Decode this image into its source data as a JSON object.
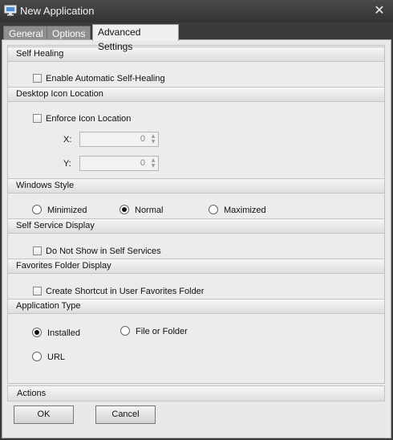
{
  "window": {
    "title": "New Application",
    "icon": "monitor-icon",
    "close_glyph": "✕"
  },
  "tabs": [
    {
      "label": "General",
      "active": false
    },
    {
      "label": "Options",
      "active": false
    },
    {
      "label": "Advanced Settings",
      "active": true
    }
  ],
  "sections": {
    "self_healing": {
      "title": "Self Healing",
      "checkbox": {
        "label": "Enable Automatic Self-Healing",
        "checked": false
      }
    },
    "desktop_icon": {
      "title": "Desktop Icon Location",
      "checkbox": {
        "label": "Enforce Icon Location",
        "checked": false
      },
      "x_label": "X:",
      "x_value": "0",
      "y_label": "Y:",
      "y_value": "0"
    },
    "windows_style": {
      "title": "Windows Style",
      "options": [
        {
          "label": "Minimized",
          "selected": false
        },
        {
          "label": "Normal",
          "selected": true
        },
        {
          "label": "Maximized",
          "selected": false
        }
      ]
    },
    "self_service": {
      "title": "Self Service Display",
      "checkbox": {
        "label": "Do Not Show in Self Services",
        "checked": false
      }
    },
    "favorites": {
      "title": "Favorites Folder Display",
      "checkbox": {
        "label": "Create Shortcut in User Favorites Folder",
        "checked": false
      }
    },
    "app_type": {
      "title": "Application Type",
      "options": [
        {
          "label": "Installed",
          "selected": true
        },
        {
          "label": "File or Folder",
          "selected": false
        },
        {
          "label": "URL",
          "selected": false
        }
      ]
    }
  },
  "actions": {
    "title": "Actions",
    "ok_label": "OK",
    "cancel_label": "Cancel"
  },
  "colors": {
    "title_bar": "#3a3a3a",
    "panel": "#e9e9e9",
    "inactive_tab": "#8f8f8f"
  }
}
